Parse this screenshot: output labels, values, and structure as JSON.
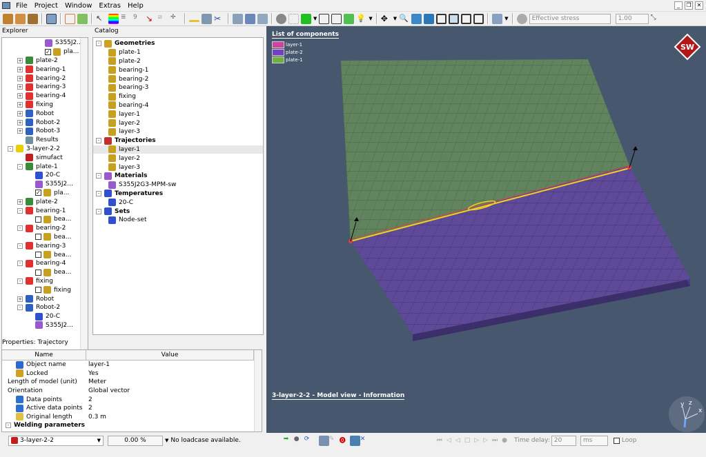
{
  "menu": {
    "items": [
      "File",
      "Project",
      "Window",
      "Extras",
      "Help"
    ]
  },
  "toolbar": {
    "result_type": "Effective stress",
    "scale": "1.00"
  },
  "explorer": {
    "title": "Explorer",
    "items": [
      {
        "label": "S355J2...",
        "level": 3,
        "icon": "material-icon",
        "color": "#9b59d0"
      },
      {
        "label": "pla...",
        "level": 3,
        "icon": "geometry-icon",
        "check": true,
        "color": "#c8a020"
      },
      {
        "label": "plate-2",
        "level": 1,
        "icon": "plate-icon",
        "pm": "+",
        "color": "#3a8a3a"
      },
      {
        "label": "bearing-1",
        "level": 1,
        "icon": "bearing-icon",
        "pm": "+",
        "color": "#e03030"
      },
      {
        "label": "bearing-2",
        "level": 1,
        "icon": "bearing-icon",
        "pm": "+",
        "color": "#e03030"
      },
      {
        "label": "bearing-3",
        "level": 1,
        "icon": "bearing-icon",
        "pm": "+",
        "color": "#e03030"
      },
      {
        "label": "bearing-4",
        "level": 1,
        "icon": "bearing-icon",
        "pm": "+",
        "color": "#e03030"
      },
      {
        "label": "fixing",
        "level": 1,
        "icon": "fixing-icon",
        "pm": "+",
        "color": "#e03030"
      },
      {
        "label": "Robot",
        "level": 1,
        "icon": "robot-icon",
        "pm": "+",
        "color": "#3060c0"
      },
      {
        "label": "Robot-2",
        "level": 1,
        "icon": "robot-icon",
        "pm": "+",
        "color": "#3060c0"
      },
      {
        "label": "Robot-3",
        "level": 1,
        "icon": "robot-icon",
        "pm": "+",
        "color": "#3060c0"
      },
      {
        "label": "Results",
        "level": 1,
        "icon": "results-icon",
        "color": "#7090a0"
      },
      {
        "label": "3-layer-2-2",
        "level": 0,
        "icon": "warning-icon",
        "pm": "-",
        "color": "#e8d000"
      },
      {
        "label": "simufact",
        "level": 1,
        "icon": "simufact-icon",
        "color": "#c02020"
      },
      {
        "label": "plate-1",
        "level": 1,
        "icon": "plate-icon",
        "pm": "-",
        "color": "#3a8a3a"
      },
      {
        "label": "20-C",
        "level": 2,
        "icon": "temperature-icon",
        "color": "#3050d0"
      },
      {
        "label": "S355J2...",
        "level": 2,
        "icon": "material-icon",
        "color": "#9b59d0"
      },
      {
        "label": "pla...",
        "level": 2,
        "icon": "geometry-icon",
        "check": true,
        "color": "#c8a020"
      },
      {
        "label": "plate-2",
        "level": 1,
        "icon": "plate-icon",
        "pm": "+",
        "color": "#3a8a3a"
      },
      {
        "label": "bearing-1",
        "level": 1,
        "icon": "bearing-icon",
        "pm": "-",
        "color": "#e03030"
      },
      {
        "label": "bea...",
        "level": 2,
        "icon": "geometry-icon",
        "check": false,
        "color": "#c8a020"
      },
      {
        "label": "bearing-2",
        "level": 1,
        "icon": "bearing-icon",
        "pm": "-",
        "color": "#e03030"
      },
      {
        "label": "bea...",
        "level": 2,
        "icon": "geometry-icon",
        "check": false,
        "color": "#c8a020"
      },
      {
        "label": "bearing-3",
        "level": 1,
        "icon": "bearing-icon",
        "pm": "-",
        "color": "#e03030"
      },
      {
        "label": "bea...",
        "level": 2,
        "icon": "geometry-icon",
        "check": false,
        "color": "#c8a020"
      },
      {
        "label": "bearing-4",
        "level": 1,
        "icon": "bearing-icon",
        "pm": "-",
        "color": "#e03030"
      },
      {
        "label": "bea...",
        "level": 2,
        "icon": "geometry-icon",
        "check": false,
        "color": "#c8a020"
      },
      {
        "label": "fixing",
        "level": 1,
        "icon": "fixing-icon",
        "pm": "-",
        "color": "#e03030"
      },
      {
        "label": "fixing",
        "level": 2,
        "icon": "geometry-icon",
        "check": false,
        "color": "#c8a020"
      },
      {
        "label": "Robot",
        "level": 1,
        "icon": "robot-icon",
        "pm": "+",
        "color": "#3060c0"
      },
      {
        "label": "Robot-2",
        "level": 1,
        "icon": "robot-icon",
        "pm": "-",
        "color": "#3060c0"
      },
      {
        "label": "20-C",
        "level": 2,
        "icon": "temperature-icon",
        "color": "#3050d0"
      },
      {
        "label": "S355J2...",
        "level": 2,
        "icon": "material-icon",
        "color": "#9b59d0"
      }
    ]
  },
  "catalog": {
    "title": "Catalog",
    "items": [
      {
        "label": "Geometries",
        "group": true,
        "icon": "geometries-icon",
        "color": "#d0a020"
      },
      {
        "label": "plate-1",
        "icon": "geometry-icon",
        "color": "#c8a020"
      },
      {
        "label": "plate-2",
        "icon": "geometry-icon",
        "color": "#c8a020"
      },
      {
        "label": "bearing-1",
        "icon": "geometry-icon",
        "color": "#c8a020"
      },
      {
        "label": "bearing-2",
        "icon": "geometry-icon",
        "color": "#c8a020"
      },
      {
        "label": "bearing-3",
        "icon": "geometry-icon",
        "color": "#c8a020"
      },
      {
        "label": "fixing",
        "icon": "geometry-icon",
        "color": "#c8a020"
      },
      {
        "label": "bearing-4",
        "icon": "geometry-icon",
        "color": "#c8a020"
      },
      {
        "label": "layer-1",
        "icon": "geometry-icon",
        "color": "#c8a020"
      },
      {
        "label": "layer-2",
        "icon": "geometry-icon",
        "color": "#c8a020"
      },
      {
        "label": "layer-3",
        "icon": "geometry-icon",
        "color": "#c8a020"
      },
      {
        "label": "Trajectories",
        "group": true,
        "icon": "trajectories-icon",
        "color": "#c03030"
      },
      {
        "label": "layer-1",
        "icon": "trajectory-icon",
        "color": "#c8a020",
        "selected": true
      },
      {
        "label": "layer-2",
        "icon": "trajectory-icon",
        "color": "#c8a020"
      },
      {
        "label": "layer-3",
        "icon": "trajectory-icon",
        "color": "#c8a020"
      },
      {
        "label": "Materials",
        "group": true,
        "icon": "materials-icon",
        "color": "#9b59d0"
      },
      {
        "label": "S355J2G3-MPM-sw",
        "icon": "material-icon",
        "color": "#9b59d0"
      },
      {
        "label": "Temperatures",
        "group": true,
        "icon": "temperatures-icon",
        "color": "#3050d0"
      },
      {
        "label": "20-C",
        "icon": "temperature-icon",
        "color": "#3050d0"
      },
      {
        "label": "Sets",
        "group": true,
        "icon": "sets-icon",
        "color": "#3050d0"
      },
      {
        "label": "Node-set",
        "icon": "node-set-icon",
        "color": "#3050d0"
      }
    ]
  },
  "viewport": {
    "list_title": "List of components",
    "components": [
      {
        "name": "layer-1",
        "color": "#d040a0"
      },
      {
        "name": "plate-2",
        "color": "#7040c0"
      },
      {
        "name": "plate-1",
        "color": "#70b040"
      }
    ],
    "info": "3-layer-2-2 - Model view - Information",
    "logo": "SW",
    "colors": {
      "background": "#47586e",
      "plate1": "#61845e",
      "plate2": "#5f4a9a",
      "weld": "#f0d020"
    },
    "axes": [
      "y",
      "z",
      "x"
    ]
  },
  "properties": {
    "title": "Properties: Trajectory",
    "col_name": "Name",
    "col_value": "Value",
    "rows": [
      {
        "name": "Object name",
        "value": "layer-1",
        "icon": "pencil-icon"
      },
      {
        "name": "Locked",
        "value": "Yes",
        "icon": "lock-icon"
      },
      {
        "name": "Length of model (unit)",
        "value": "Meter"
      },
      {
        "name": "Orientation",
        "value": "Global vector"
      },
      {
        "name": "Data points",
        "value": "2",
        "icon": "sigma-icon"
      },
      {
        "name": "Active data points",
        "value": "2",
        "icon": "sigma-icon"
      },
      {
        "name": "Original length",
        "value": "0.3 m",
        "icon": "ruler-icon"
      }
    ],
    "group": "Welding parameters"
  },
  "status": {
    "project": "3-layer-2-2",
    "progress": "0.00 %",
    "loadcase": "No loadcase available.",
    "time_delay_label": "Time delay:",
    "time_delay": "20",
    "unit": "ms",
    "loop": "Loop"
  }
}
